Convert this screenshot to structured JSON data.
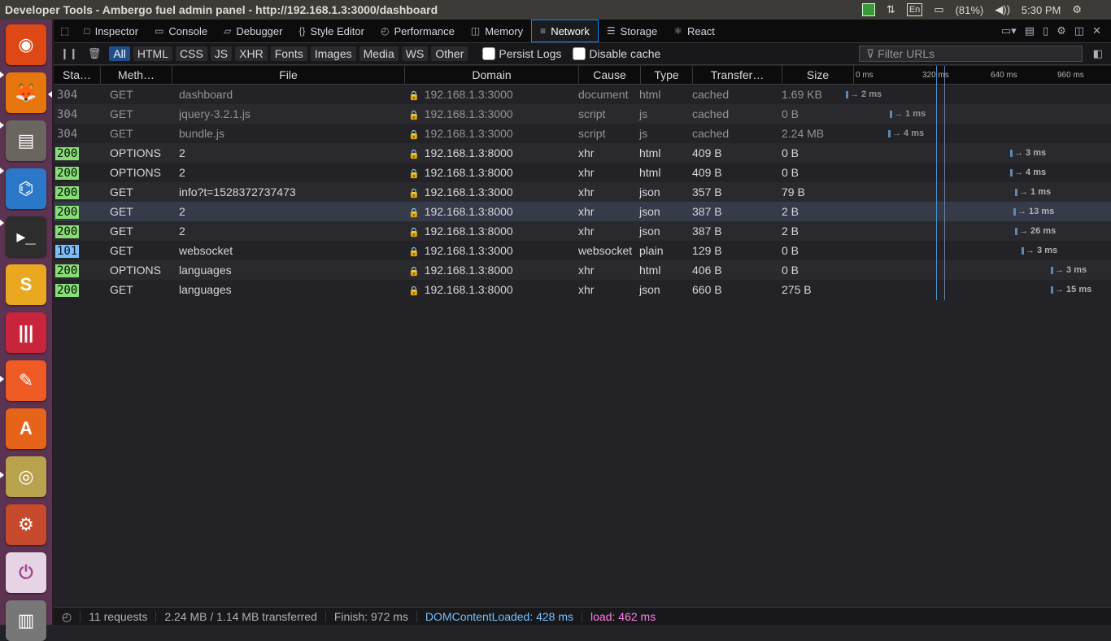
{
  "window_title": "Developer Tools - Ambergo fuel admin panel - http://192.168.1.3:3000/dashboard",
  "indicators": {
    "lang": "En",
    "battery": "(81%)",
    "time": "5:30 PM"
  },
  "launcher": [
    "ubuntu-dash-icon",
    "firefox-icon",
    "files-icon",
    "vscode-icon",
    "terminal-icon",
    "slack-icon",
    "gitkraken-icon",
    "postman-icon",
    "software-center-icon",
    "audio-player-icon",
    "system-settings-icon",
    "power-icon",
    "trash-icon"
  ],
  "tabs": [
    {
      "label": "Inspector",
      "icon": "□"
    },
    {
      "label": "Console",
      "icon": "▭"
    },
    {
      "label": "Debugger",
      "icon": "▱"
    },
    {
      "label": "Style Editor",
      "icon": "{}"
    },
    {
      "label": "Performance",
      "icon": "◴"
    },
    {
      "label": "Memory",
      "icon": "◫"
    },
    {
      "label": "Network",
      "icon": "≡"
    },
    {
      "label": "Storage",
      "icon": "☰"
    },
    {
      "label": "React",
      "icon": "⚛"
    }
  ],
  "filters": [
    "All",
    "HTML",
    "CSS",
    "JS",
    "XHR",
    "Fonts",
    "Images",
    "Media",
    "WS",
    "Other"
  ],
  "persist_logs": "Persist Logs",
  "disable_cache": "Disable cache",
  "filter_placeholder": "Filter URLs",
  "columns": [
    "Sta…",
    "Meth…",
    "File",
    "Domain",
    "Cause",
    "Type",
    "Transfer…",
    "Size"
  ],
  "timeline_ticks": [
    "0 ms",
    "320 ms",
    "640 ms",
    "960 ms"
  ],
  "requests": [
    {
      "status": "304",
      "method": "GET",
      "file": "dashboard",
      "domain": "192.168.1.3:3000",
      "cause": "document",
      "type": "html",
      "transferred": "cached",
      "size": "1.69 KB",
      "timing": "→ 2 ms",
      "cached": true
    },
    {
      "status": "304",
      "method": "GET",
      "file": "jquery-3.2.1.js",
      "domain": "192.168.1.3:3000",
      "cause": "script",
      "type": "js",
      "transferred": "cached",
      "size": "0 B",
      "timing": "→ 1 ms",
      "cached": true
    },
    {
      "status": "304",
      "method": "GET",
      "file": "bundle.js",
      "domain": "192.168.1.3:3000",
      "cause": "script",
      "type": "js",
      "transferred": "cached",
      "size": "2.24 MB",
      "timing": "→ 4 ms",
      "cached": true
    },
    {
      "status": "200",
      "method": "OPTIONS",
      "file": "2",
      "domain": "192.168.1.3:8000",
      "cause": "xhr",
      "type": "html",
      "transferred": "409 B",
      "size": "0 B",
      "timing": "→ 3 ms",
      "cached": false
    },
    {
      "status": "200",
      "method": "OPTIONS",
      "file": "2",
      "domain": "192.168.1.3:8000",
      "cause": "xhr",
      "type": "html",
      "transferred": "409 B",
      "size": "0 B",
      "timing": "→ 4 ms",
      "cached": false
    },
    {
      "status": "200",
      "method": "GET",
      "file": "info?t=1528372737473",
      "domain": "192.168.1.3:3000",
      "cause": "xhr",
      "type": "json",
      "transferred": "357 B",
      "size": "79 B",
      "timing": "→ 1 ms",
      "cached": false
    },
    {
      "status": "200",
      "method": "GET",
      "file": "2",
      "domain": "192.168.1.3:8000",
      "cause": "xhr",
      "type": "json",
      "transferred": "387 B",
      "size": "2 B",
      "timing": "→ 13 ms",
      "cached": false
    },
    {
      "status": "200",
      "method": "GET",
      "file": "2",
      "domain": "192.168.1.3:8000",
      "cause": "xhr",
      "type": "json",
      "transferred": "387 B",
      "size": "2 B",
      "timing": "→ 26 ms",
      "cached": false
    },
    {
      "status": "101",
      "method": "GET",
      "file": "websocket",
      "domain": "192.168.1.3:3000",
      "cause": "websocket",
      "type": "plain",
      "transferred": "129 B",
      "size": "0 B",
      "timing": "→ 3 ms",
      "cached": false
    },
    {
      "status": "200",
      "method": "OPTIONS",
      "file": "languages",
      "domain": "192.168.1.3:8000",
      "cause": "xhr",
      "type": "html",
      "transferred": "406 B",
      "size": "0 B",
      "timing": "→ 3 ms",
      "cached": false
    },
    {
      "status": "200",
      "method": "GET",
      "file": "languages",
      "domain": "192.168.1.3:8000",
      "cause": "xhr",
      "type": "json",
      "transferred": "660 B",
      "size": "275 B",
      "timing": "→ 15 ms",
      "cached": false
    }
  ],
  "status_bar": {
    "requests": "11 requests",
    "transferred": "2.24 MB / 1.14 MB transferred",
    "finish": "Finish: 972 ms",
    "dom": "DOMContentLoaded: 428 ms",
    "load": "load: 462 ms"
  },
  "colors": {
    "status_200": "#86de74",
    "status_101": "#75bfff",
    "dom_color": "#75bfff",
    "load_color": "#ff7de9",
    "accent": "#0a84ff"
  }
}
